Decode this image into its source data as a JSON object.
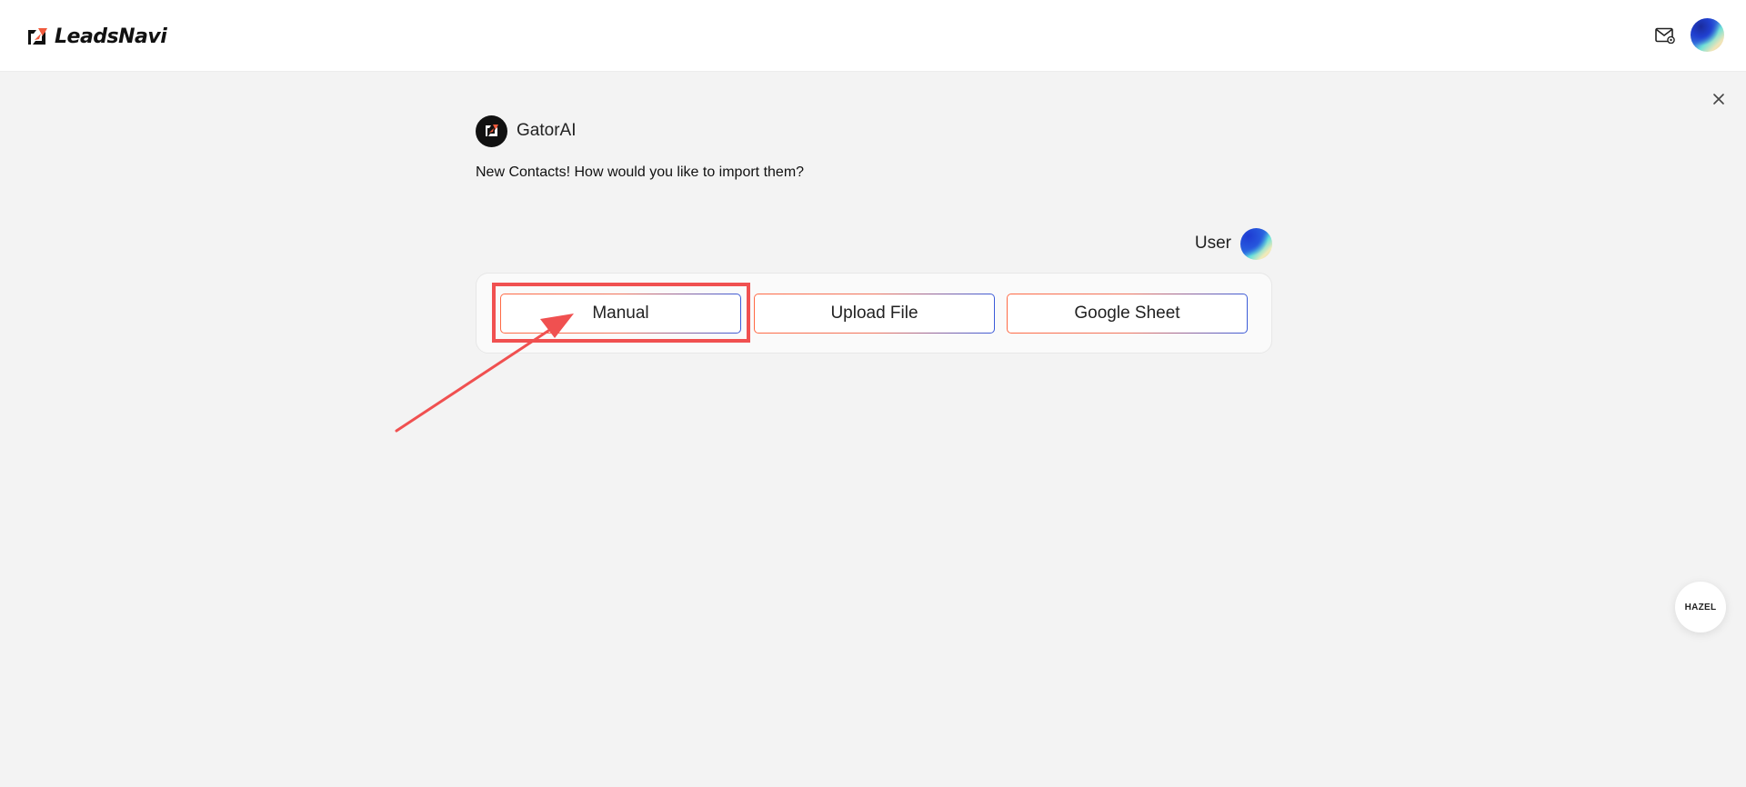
{
  "app": {
    "name": "LeadsNavi"
  },
  "header": {
    "mail_icon": "mail-settings-icon",
    "avatar": "user-avatar"
  },
  "chat": {
    "bot_name": "GatorAI",
    "bot_message": "New Contacts! How would you like to import them?",
    "user_label": "User"
  },
  "options": {
    "manual_label": "Manual",
    "upload_label": "Upload File",
    "sheet_label": "Google Sheet"
  },
  "floating": {
    "hazel_label": "HAZEL"
  },
  "colors": {
    "accent_orange": "#ff6a45",
    "accent_blue": "#3a5bd9",
    "annotation_red": "#f05050",
    "page_bg": "#f3f3f3"
  }
}
